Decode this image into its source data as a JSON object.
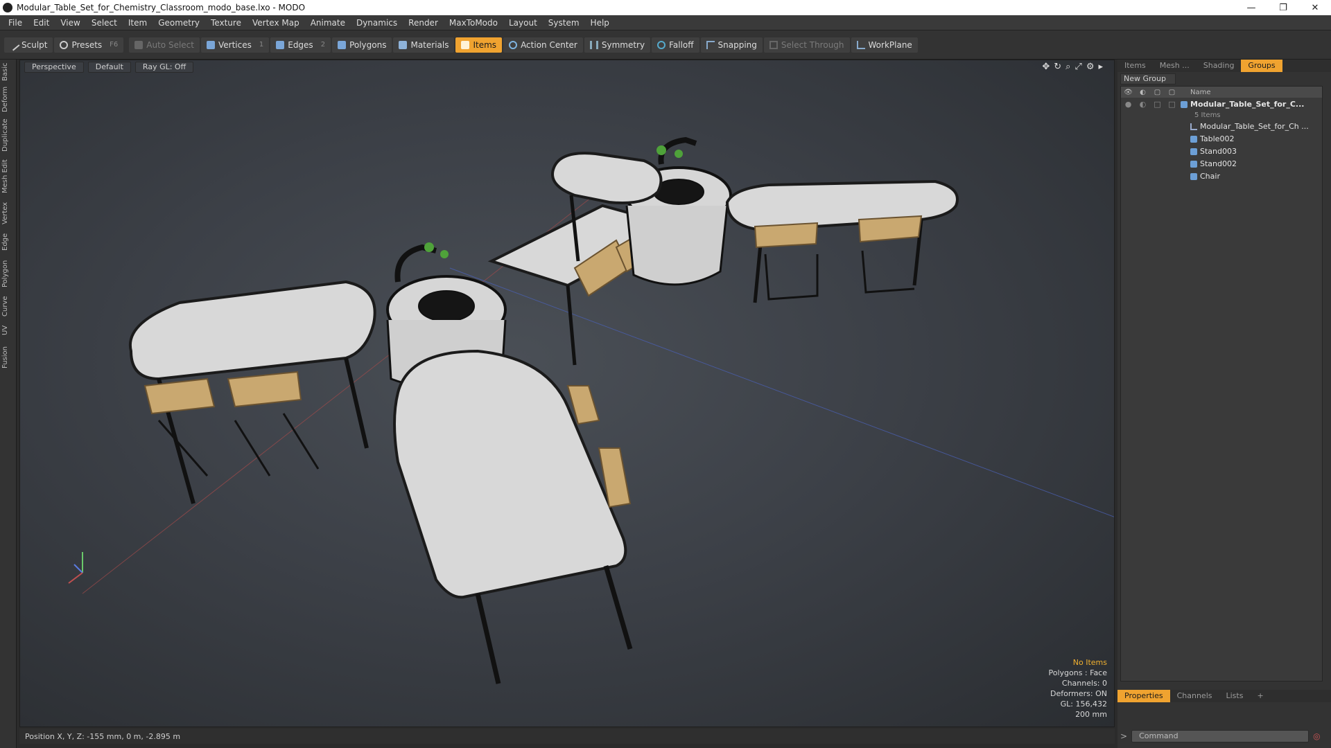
{
  "window": {
    "title": "Modular_Table_Set_for_Chemistry_Classroom_modo_base.lxo - MODO",
    "minimize": "—",
    "maximize": "❐",
    "close": "✕"
  },
  "menu": [
    "File",
    "Edit",
    "View",
    "Select",
    "Item",
    "Geometry",
    "Texture",
    "Vertex Map",
    "Animate",
    "Dynamics",
    "Render",
    "MaxToModo",
    "Layout",
    "System",
    "Help"
  ],
  "toolbar": {
    "sculpt": "Sculpt",
    "presets": "Presets",
    "presets_key": "F6",
    "auto_select": "Auto Select",
    "vertices": "Vertices",
    "vertices_key": "1",
    "edges": "Edges",
    "edges_key": "2",
    "polygons": "Polygons",
    "materials": "Materials",
    "items": "Items",
    "action_center": "Action Center",
    "symmetry": "Symmetry",
    "falloff": "Falloff",
    "snapping": "Snapping",
    "select_through": "Select Through",
    "workplane": "WorkPlane"
  },
  "left_tabs": [
    "Basic",
    "Deform",
    "Duplicate",
    "Mesh Edit",
    "Vertex",
    "Edge",
    "Polygon",
    "Curve",
    "UV",
    "Fusion"
  ],
  "viewport": {
    "view": "Perspective",
    "shading": "Default",
    "raygl": "Ray GL: Off",
    "stats": {
      "selection": "No Items",
      "polygons": "Polygons : Face",
      "channels": "Channels: 0",
      "deformers": "Deformers: ON",
      "gl": "GL: 156,432",
      "scale": "200 mm"
    }
  },
  "status": {
    "position": "Position X, Y, Z:  -155 mm, 0 m, -2.895 m"
  },
  "panel": {
    "tabs": [
      "Items",
      "Mesh ...",
      "Shading",
      "Groups"
    ],
    "active_tab": "Groups",
    "new_group": "New Group",
    "name_col": "Name",
    "tree": {
      "root": "Modular_Table_Set_for_C...",
      "root_count": "5 Items",
      "children": [
        "Modular_Table_Set_for_Ch ...",
        "Table002",
        "Stand003",
        "Stand002",
        "Chair"
      ]
    },
    "bottom_tabs": [
      "Properties",
      "Channels",
      "Lists",
      "+"
    ],
    "command_placeholder": "Command"
  },
  "colors": {
    "accent": "#f0a330",
    "background": "#2b2b2b"
  }
}
